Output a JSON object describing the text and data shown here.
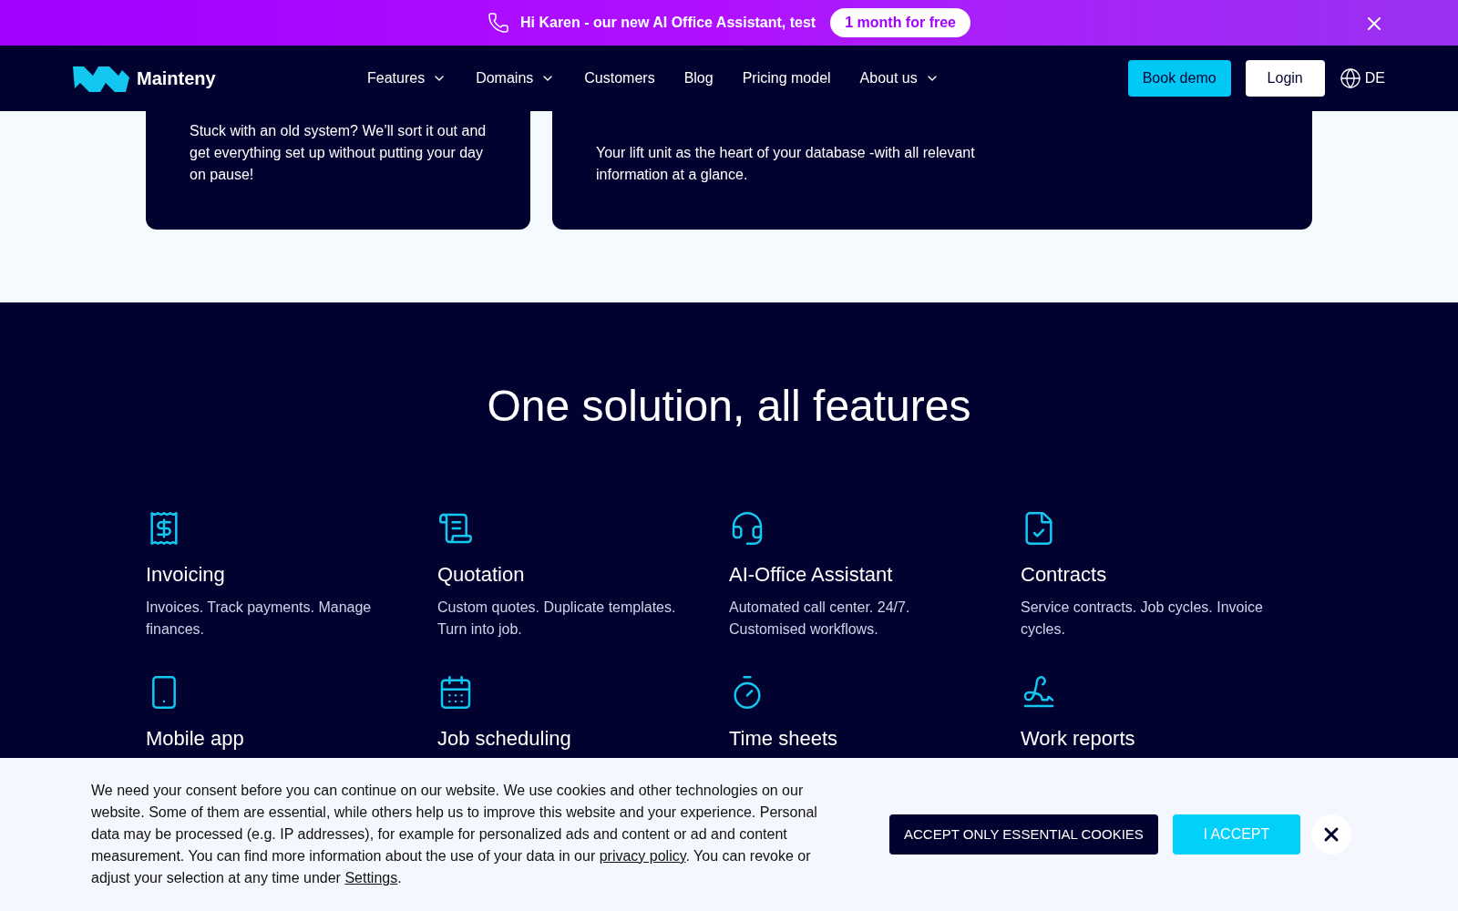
{
  "promo_banner": {
    "text": "Hi Karen - our new AI Office Assistant, test",
    "offer": "1 month for free"
  },
  "nav": {
    "logo": "Mainteny",
    "items": [
      {
        "label": "Features",
        "dropdown": true
      },
      {
        "label": "Domains",
        "dropdown": true
      },
      {
        "label": "Customers",
        "dropdown": false
      },
      {
        "label": "Blog",
        "dropdown": false
      },
      {
        "label": "Pricing model",
        "dropdown": false
      },
      {
        "label": "About us",
        "dropdown": true
      }
    ],
    "book_demo": "Book demo",
    "login": "Login",
    "language": "DE"
  },
  "cards": [
    {
      "text": "Stuck with an old system? We’ll sort it out and get everything set up without putting your day on pause!"
    },
    {
      "text": "Your lift unit as the heart of your database -with all relevant information at a glance."
    }
  ],
  "features_section": {
    "heading": "One solution, all features",
    "features": [
      {
        "title": "Invoicing",
        "description": "Invoices. Track payments. Manage finances."
      },
      {
        "title": "Quotation",
        "description": "Custom quotes. Duplicate templates. Turn into job."
      },
      {
        "title": "AI-Office Assistant",
        "description": "Automated call center. 24/7. Customised workflows."
      },
      {
        "title": "Contracts",
        "description": "Service contracts. Job cycles. Invoice cycles."
      },
      {
        "title": "Mobile app"
      },
      {
        "title": "Job scheduling"
      },
      {
        "title": "Time sheets"
      },
      {
        "title": "Work reports"
      }
    ]
  },
  "cookie_banner": {
    "parts": [
      {
        "kind": "text",
        "text": "We need your consent before you can continue on our website. We use cookies and other technologies on our website. Some of them are essential, while others help us to improve this website and your experience. Personal data may be processed (e.g. IP addresses), for example for personalized ads and content or ad and content measurement. You can find more information about the use of your data in our "
      },
      {
        "kind": "link",
        "text": "privacy policy"
      },
      {
        "kind": "text",
        "text": ". You can revoke or adjust your selection at any time under "
      },
      {
        "kind": "link",
        "text": "Settings"
      },
      {
        "kind": "text",
        "text": "."
      }
    ],
    "essential_button": "ACCEPT ONLY ESSENTIAL COOKIES",
    "accept_button": "I ACCEPT"
  }
}
